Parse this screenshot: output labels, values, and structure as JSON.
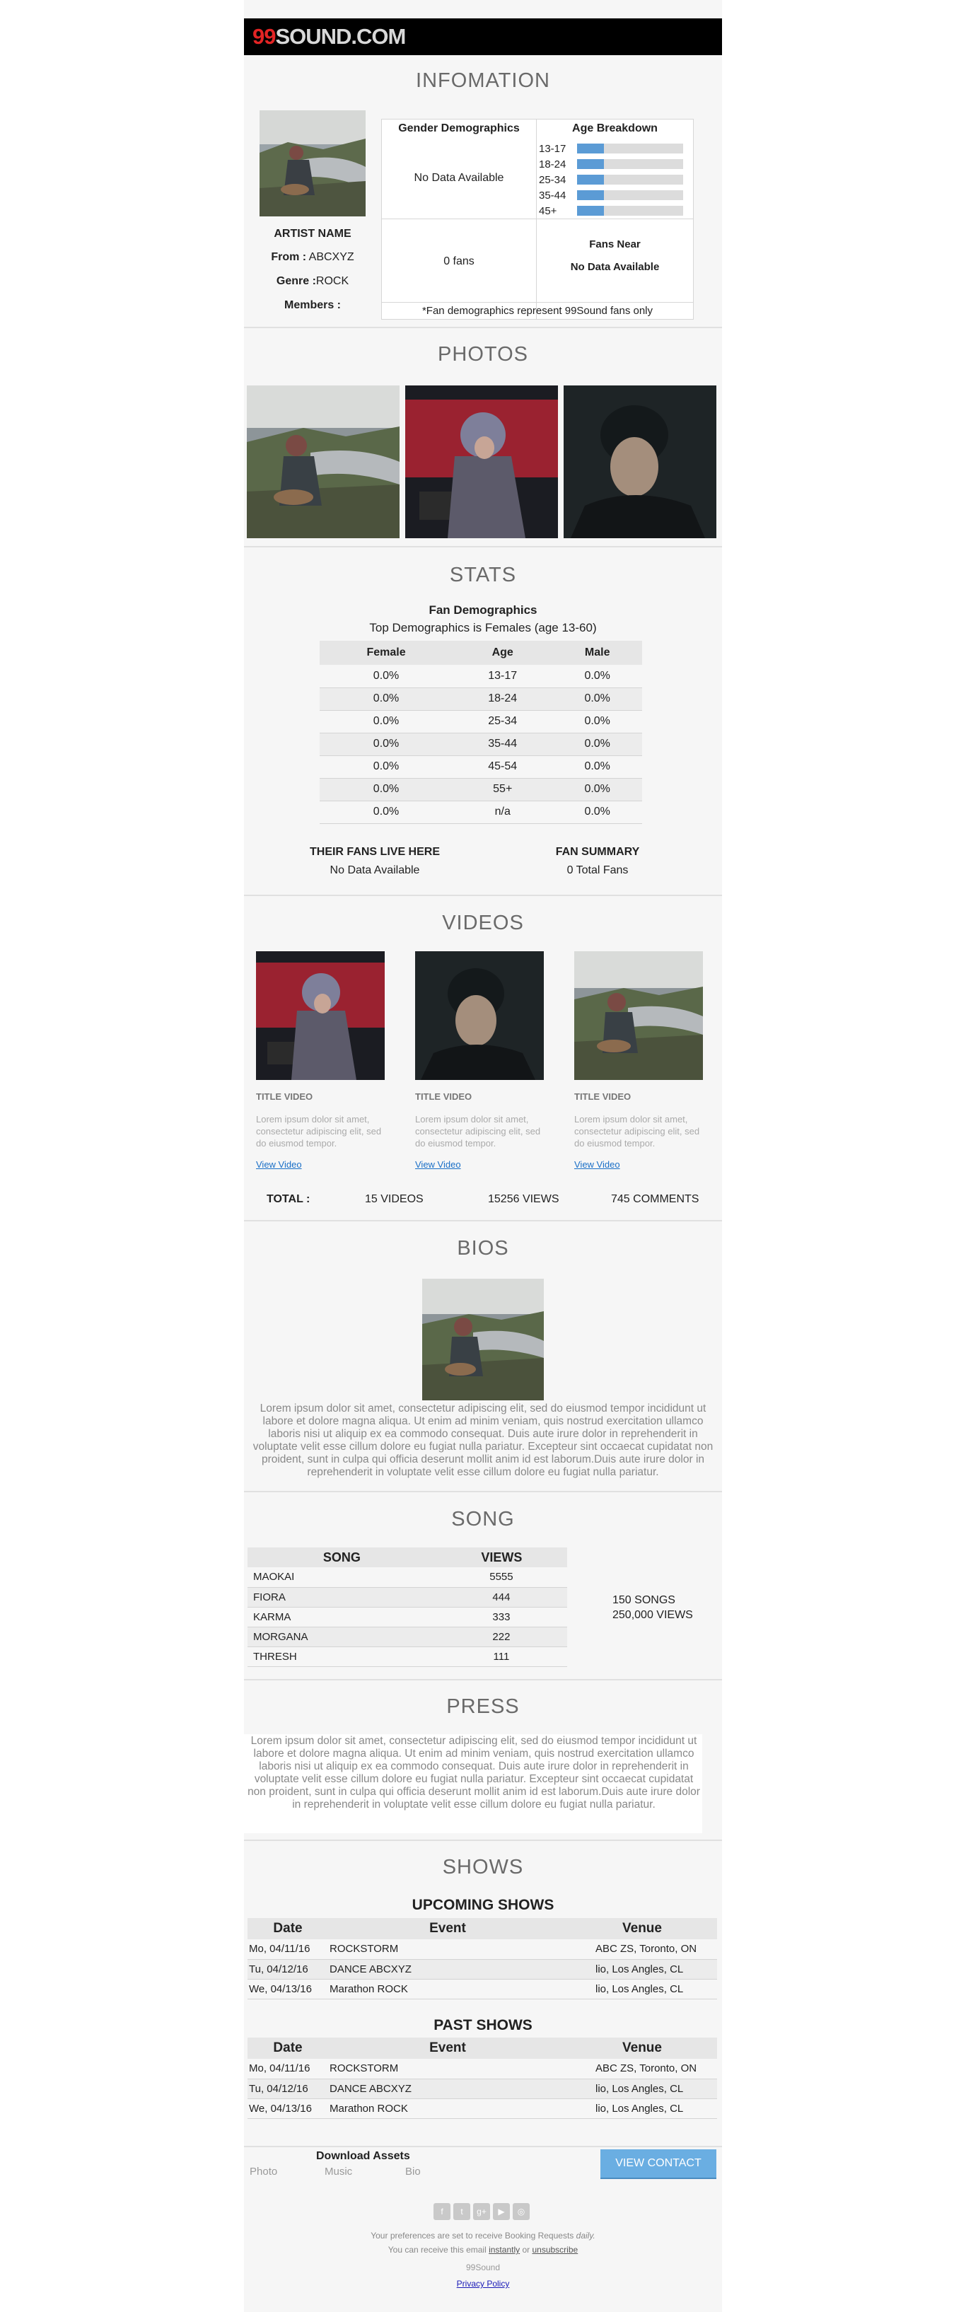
{
  "brand": {
    "logo_num": "99",
    "logo_text": "SOUND.COM"
  },
  "info": {
    "title": "INFOMATION",
    "artist_name": "ARTIST NAME",
    "from_label": "From :",
    "from_value": "ABCXYZ",
    "genre_label": "Genre :",
    "genre_value": "ROCK",
    "members_label": "Members :",
    "gender_heading": "Gender Demographics",
    "gender_value": "No Data Available",
    "age_heading": "Age Breakdown",
    "ages": [
      {
        "label": "13-17",
        "fill": 0.25
      },
      {
        "label": "18-24",
        "fill": 0.25
      },
      {
        "label": "25-34",
        "fill": 0.25
      },
      {
        "label": "35-44",
        "fill": 0.25
      },
      {
        "label": "45+",
        "fill": 0.25
      }
    ],
    "fans_count": "0 fans",
    "fans_near_heading": "Fans Near",
    "fans_near_value": "No Data Available",
    "note": "*Fan demographics represent 99Sound fans only"
  },
  "photos": {
    "title": "PHOTOS"
  },
  "stats": {
    "title": "STATS",
    "heading": "Fan Demographics",
    "subheading": "Top Demographics is Females (age 13-60)",
    "columns": [
      "Female",
      "Age",
      "Male"
    ],
    "rows": [
      [
        "0.0%",
        "13-17",
        "0.0%"
      ],
      [
        "0.0%",
        "18-24",
        "0.0%"
      ],
      [
        "0.0%",
        "25-34",
        "0.0%"
      ],
      [
        "0.0%",
        "35-44",
        "0.0%"
      ],
      [
        "0.0%",
        "45-54",
        "0.0%"
      ],
      [
        "0.0%",
        "55+",
        "0.0%"
      ],
      [
        "0.0%",
        "n/a",
        "0.0%"
      ]
    ],
    "fans_live_heading": "THEIR FANS LIVE HERE",
    "fans_live_value": "No Data Available",
    "fan_summary_heading": "FAN SUMMARY",
    "fan_summary_value": "0 Total Fans"
  },
  "videos": {
    "title": "VIDEOS",
    "items": [
      {
        "title": "TITLE VIDEO",
        "desc": "Lorem ipsum dolor sit amet, consectetur adipiscing elit, sed do eiusmod tempor.",
        "link": "View Video"
      },
      {
        "title": "TITLE VIDEO",
        "desc": "Lorem ipsum dolor sit amet, consectetur adipiscing elit, sed do eiusmod tempor.",
        "link": "View Video"
      },
      {
        "title": "TITLE VIDEO",
        "desc": "Lorem ipsum dolor sit amet, consectetur adipiscing elit, sed do eiusmod tempor.",
        "link": "View Video"
      }
    ],
    "total_label": "TOTAL :",
    "total_videos": "15 VIDEOS",
    "total_views": "15256 VIEWS",
    "total_comments": "745 COMMENTS"
  },
  "bios": {
    "title": "BIOS",
    "text": "Lorem ipsum dolor sit amet, consectetur adipiscing elit, sed do eiusmod tempor incididunt ut labore et dolore magna aliqua. Ut enim ad minim veniam, quis nostrud exercitation ullamco laboris nisi ut aliquip ex ea commodo consequat. Duis aute irure dolor in reprehenderit in voluptate velit esse cillum dolore eu fugiat nulla pariatur. Excepteur sint occaecat cupidatat non proident, sunt in culpa qui officia deserunt mollit anim id est laborum.Duis aute irure dolor in reprehenderit in voluptate velit esse cillum dolore eu fugiat nulla pariatur."
  },
  "song": {
    "title": "SONG",
    "col_song": "SONG",
    "col_views": "VIEWS",
    "rows": [
      [
        "MAOKAI",
        "5555"
      ],
      [
        "FIORA",
        "444"
      ],
      [
        "KARMA",
        "333"
      ],
      [
        "MORGANA",
        "222"
      ],
      [
        "THRESH",
        "111"
      ]
    ],
    "summary_songs": "150 SONGS",
    "summary_views": "250,000 VIEWS"
  },
  "press": {
    "title": "PRESS",
    "text": "Lorem ipsum dolor sit amet, consectetur adipiscing elit, sed do eiusmod tempor incididunt ut labore et dolore magna aliqua. Ut enim ad minim veniam, quis nostrud exercitation ullamco laboris nisi ut aliquip ex ea commodo consequat. Duis aute irure dolor in reprehenderit in voluptate velit esse cillum dolore eu fugiat nulla pariatur. Excepteur sint occaecat cupidatat non proident, sunt in culpa qui officia deserunt mollit anim id est laborum.Duis aute irure dolor in reprehenderit in voluptate velit esse cillum dolore eu fugiat nulla pariatur."
  },
  "shows": {
    "title": "SHOWS",
    "upcoming_title": "UPCOMING SHOWS",
    "past_title": "PAST SHOWS",
    "columns": [
      "Date",
      "Event",
      "Venue"
    ],
    "upcoming": [
      [
        "Mo, 04/11/16",
        "ROCKSTORM",
        "ABC ZS, Toronto, ON"
      ],
      [
        "Tu, 04/12/16",
        "DANCE ABCXYZ",
        "lio, Los Angles, CL"
      ],
      [
        "We, 04/13/16",
        "Marathon ROCK",
        "lio, Los Angles, CL"
      ]
    ],
    "past": [
      [
        "Mo, 04/11/16",
        "ROCKSTORM",
        "ABC ZS, Toronto, ON"
      ],
      [
        "Tu, 04/12/16",
        "DANCE ABCXYZ",
        "lio, Los Angles, CL"
      ],
      [
        "We, 04/13/16",
        "Marathon ROCK",
        "lio, Los Angles, CL"
      ]
    ]
  },
  "download": {
    "heading": "Download Assets",
    "photo": "Photo",
    "music": "Music",
    "bio": "Bio",
    "contact_button": "VIEW CONTACT"
  },
  "footer": {
    "social": [
      "facebook-icon",
      "twitter-icon",
      "google-plus-icon",
      "youtube-icon",
      "instagram-icon"
    ],
    "pref_text": "Your preferences are set to receive Booking Requests",
    "pref_em": "daily.",
    "receive_text": "You can receive this email",
    "instantly": "instantly",
    "or": "or",
    "unsubscribe": "unsubscribe",
    "company": "99Sound",
    "privacy": "Privacy Policy"
  },
  "colors": {
    "bar": "#5b9bd5",
    "button": "#6aaee2",
    "accent": "#e32424"
  }
}
